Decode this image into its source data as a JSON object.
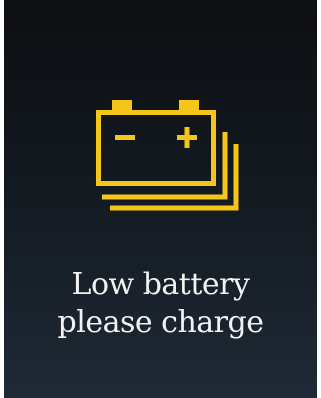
{
  "alert": {
    "icon": "battery-warning-icon",
    "line1": "Low battery",
    "line2": "please charge",
    "accent_color": "#f5c518",
    "text_color": "#f2f2f2"
  }
}
